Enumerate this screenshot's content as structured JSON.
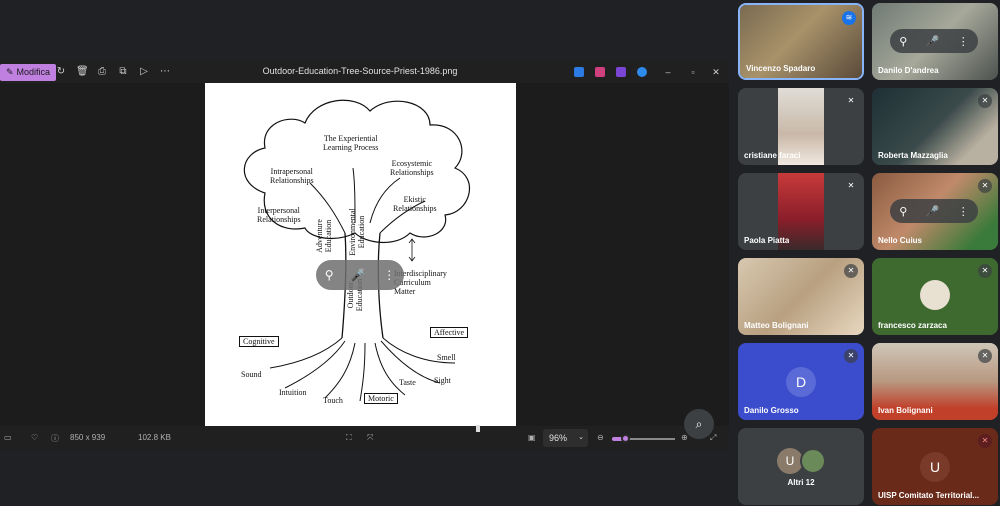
{
  "viewer": {
    "edit_label": "Modifica",
    "filename": "Outdoor-Education-Tree-Source-Priest-1986.png",
    "dimensions": "850 x 939",
    "file_size": "102.8 KB",
    "zoom": "96%",
    "zoom_fraction": 0.2
  },
  "tree": {
    "experiential": "The Experiential\nLearning Process",
    "ecosystemic": "Ecosystemic\nRelationships",
    "intrapersonal": "Intrapersonal\nRelationships",
    "interpersonal": "Interpersonal\nRelationships",
    "ekistic": "Ekistic\nRelationships",
    "adventure": "Adventure\nEducation",
    "environmental": "Environmental\nEducation",
    "interdisciplinary": "Interdisciplinary\nCurriculum\nMatter",
    "outdoor": "Outdoor\nEducation",
    "cognitive": "Cognitive",
    "affective": "Affective",
    "smell": "Smell",
    "sound": "Sound",
    "taste": "Taste",
    "sight": "Sight",
    "intuition": "Intuition",
    "touch": "Touch",
    "motoric": "Motoric"
  },
  "participants": [
    {
      "name": "Vincenzo Spadaro",
      "speaking": true
    },
    {
      "name": "Danilo D'andrea",
      "muted": false
    },
    {
      "name": "cristiane faraci",
      "muted": true
    },
    {
      "name": "Roberta Mazzaglia",
      "muted": true
    },
    {
      "name": "Paola Piatta",
      "muted": true
    },
    {
      "name": "Nello Cuius",
      "muted": true
    },
    {
      "name": "Matteo Bolignani",
      "muted": true
    },
    {
      "name": "francesco zarzaca",
      "muted": true
    },
    {
      "name": "Danilo Grosso",
      "muted": true,
      "initial": "D"
    },
    {
      "name": "Ivan Bolignani",
      "muted": true
    },
    {
      "name": "Altri 12",
      "initial": "U"
    },
    {
      "name": "UISP Comitato Territorial...",
      "muted": true,
      "initial": "U"
    }
  ]
}
